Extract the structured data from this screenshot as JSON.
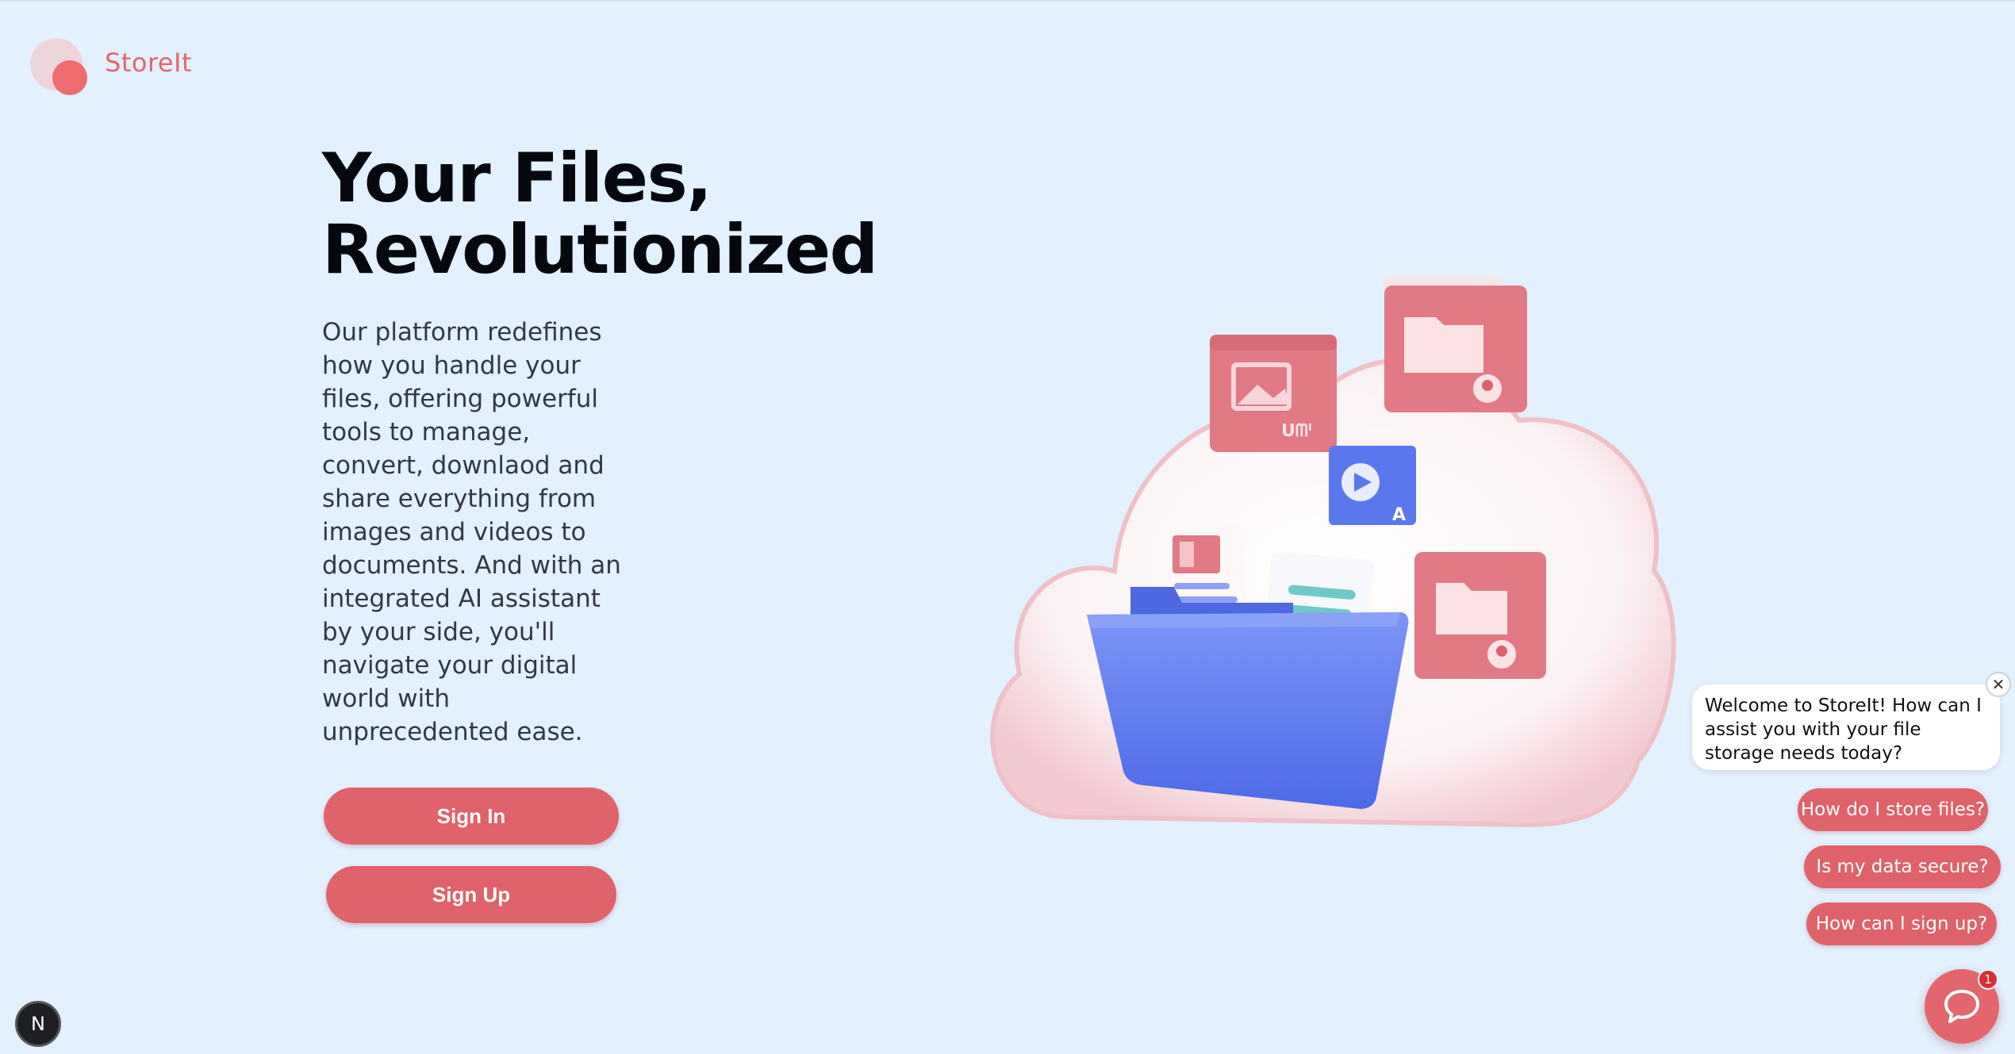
{
  "brand": {
    "name": "StoreIt"
  },
  "hero": {
    "title_line1": "Your Files,",
    "title_line2": "Revolutionized",
    "description": "Our platform redefines how you handle your files, offering powerful tools to manage, convert, downlaod and share everything from images and videos to documents. And with an integrated AI assistant by your side, you'll navigate your digital world with unprecedented ease."
  },
  "buttons": {
    "sign_in": "Sign In",
    "sign_up": "Sign Up"
  },
  "chat": {
    "welcome": "Welcome to StoreIt! How can I assist you with your file storage needs today?",
    "close_glyph": "✕",
    "quick_replies": [
      "How do I store files?",
      "Is my data secure?",
      "How can I sign up?"
    ],
    "unread_count": "1"
  },
  "dev_indicator": {
    "label": "N"
  },
  "colors": {
    "background": "#e3f0fd",
    "accent": "#e0626a",
    "folder_blue": "#5b7bf0"
  },
  "icons": [
    "chat-bubble-icon",
    "close-icon",
    "image-folder-icon",
    "folder-icon",
    "video-icon",
    "cloud-illustration"
  ]
}
